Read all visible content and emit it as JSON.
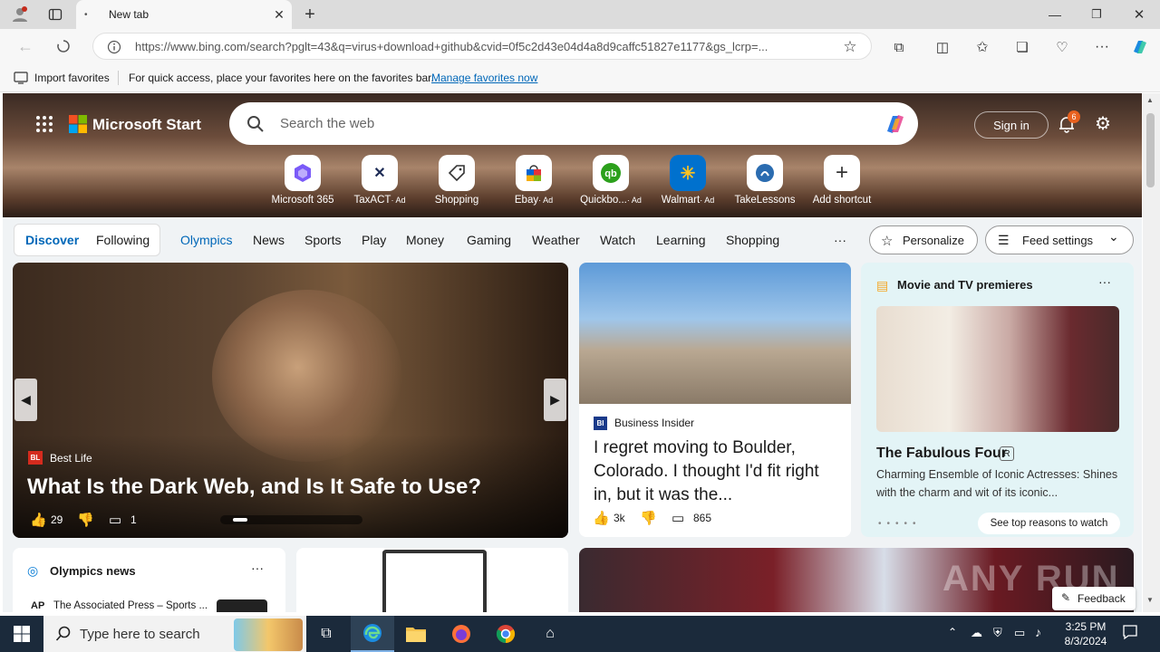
{
  "browser": {
    "tab_title": "New tab",
    "url": "https://www.bing.com/search?pglt=43&q=virus+download+github&cvid=0f5c2d43e04d4a8d9caffc51827e1177&gs_lcrp=...",
    "favbar": {
      "import_label": "Import favorites",
      "message": "For quick access, place your favorites here on the favorites bar.",
      "manage_link": "Manage favorites now"
    }
  },
  "start": {
    "brand": "Microsoft Start",
    "search_placeholder": "Search the web",
    "sign_in": "Sign in",
    "notification_count": "6",
    "shortcuts": [
      {
        "label": "Microsoft 365",
        "ad": ""
      },
      {
        "label": "TaxACT",
        "ad": "· Ad"
      },
      {
        "label": "Shopping",
        "ad": ""
      },
      {
        "label": "Ebay",
        "ad": "· Ad"
      },
      {
        "label": "Quickbo...",
        "ad": "· Ad"
      },
      {
        "label": "Walmart",
        "ad": "· Ad"
      },
      {
        "label": "TakeLessons",
        "ad": ""
      },
      {
        "label": "Add shortcut",
        "ad": ""
      }
    ],
    "nav": {
      "discover": "Discover",
      "following": "Following",
      "links": [
        "Olympics",
        "News",
        "Sports",
        "Play",
        "Money",
        "Gaming",
        "Weather",
        "Watch",
        "Learning",
        "Shopping"
      ],
      "more": "···",
      "personalize": "Personalize",
      "feed_settings": "Feed settings"
    },
    "feature": {
      "source": "Best Life",
      "title": "What Is the Dark Web, and Is It Safe to Use?",
      "likes": "29",
      "comments": "1"
    },
    "story2": {
      "source": "Business Insider",
      "title": "I regret moving to Boulder, Colorado. I thought I'd fit right in, but it was the...",
      "likes": "3k",
      "comments": "865"
    },
    "movie_card": {
      "heading": "Movie and TV premieres",
      "title": "The Fabulous Four",
      "rating": "R",
      "desc": "Charming Ensemble of Iconic Actresses: Shines with the charm and wit of its iconic...",
      "cta": "See top reasons to watch"
    },
    "olympics": {
      "heading": "Olympics news",
      "source": "The Associated Press – Sports ..."
    },
    "feedback": "Feedback",
    "watermark": "ANY RUN"
  },
  "taskbar": {
    "search_placeholder": "Type here to search",
    "time": "3:25 PM",
    "date": "8/3/2024"
  },
  "colors": {
    "accent": "#0067b8",
    "taskbar": "#1b2a3b"
  }
}
